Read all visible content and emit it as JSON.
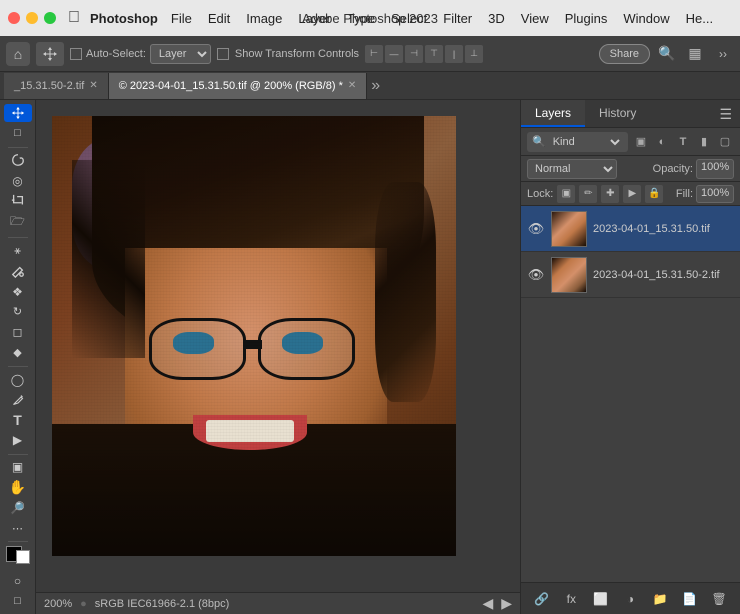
{
  "menubar": {
    "app_name": "Photoshop",
    "title": "Adobe Photoshop 2023",
    "menus": [
      "File",
      "Edit",
      "Image",
      "Layer",
      "Type",
      "Select",
      "Filter",
      "3D",
      "View",
      "Plugins",
      "Window",
      "He..."
    ]
  },
  "options_bar": {
    "auto_select_label": "Auto-Select:",
    "layer_dropdown": "Layer",
    "transform_label": "Show Transform Controls",
    "share_label": "Share"
  },
  "tabs": [
    {
      "label": "_15.31.50-2.tif",
      "active": false,
      "closeable": true
    },
    {
      "label": "© 2023-04-01_15.31.50.tif @ 200% (RGB/8) *",
      "active": true,
      "closeable": true
    }
  ],
  "canvas": {
    "zoom": "200%",
    "color_profile": "sRGB IEC61966-2.1 (8bpc)"
  },
  "panels": {
    "tabs": [
      "Layers",
      "History"
    ],
    "active_tab": "Layers"
  },
  "filter_bar": {
    "kind_label": "Kind",
    "search_placeholder": "Kind"
  },
  "blend_mode": {
    "mode": "Normal",
    "opacity_label": "Opacity:",
    "opacity_value": "100%"
  },
  "lock_bar": {
    "lock_label": "Lock:",
    "fill_label": "Fill:",
    "fill_value": "100%"
  },
  "layers": [
    {
      "name": "2023-04-01_15.31.50.tif",
      "visible": true,
      "selected": true
    },
    {
      "name": "2023-04-01_15.31.50-2.tif",
      "visible": true,
      "selected": false
    }
  ],
  "panel_bottom": {
    "link_icon": "🔗",
    "fx_label": "fx",
    "add_mask_icon": "⬜",
    "adjustment_icon": "◑",
    "group_icon": "📁",
    "new_layer_icon": "📄",
    "delete_icon": "🗑"
  }
}
